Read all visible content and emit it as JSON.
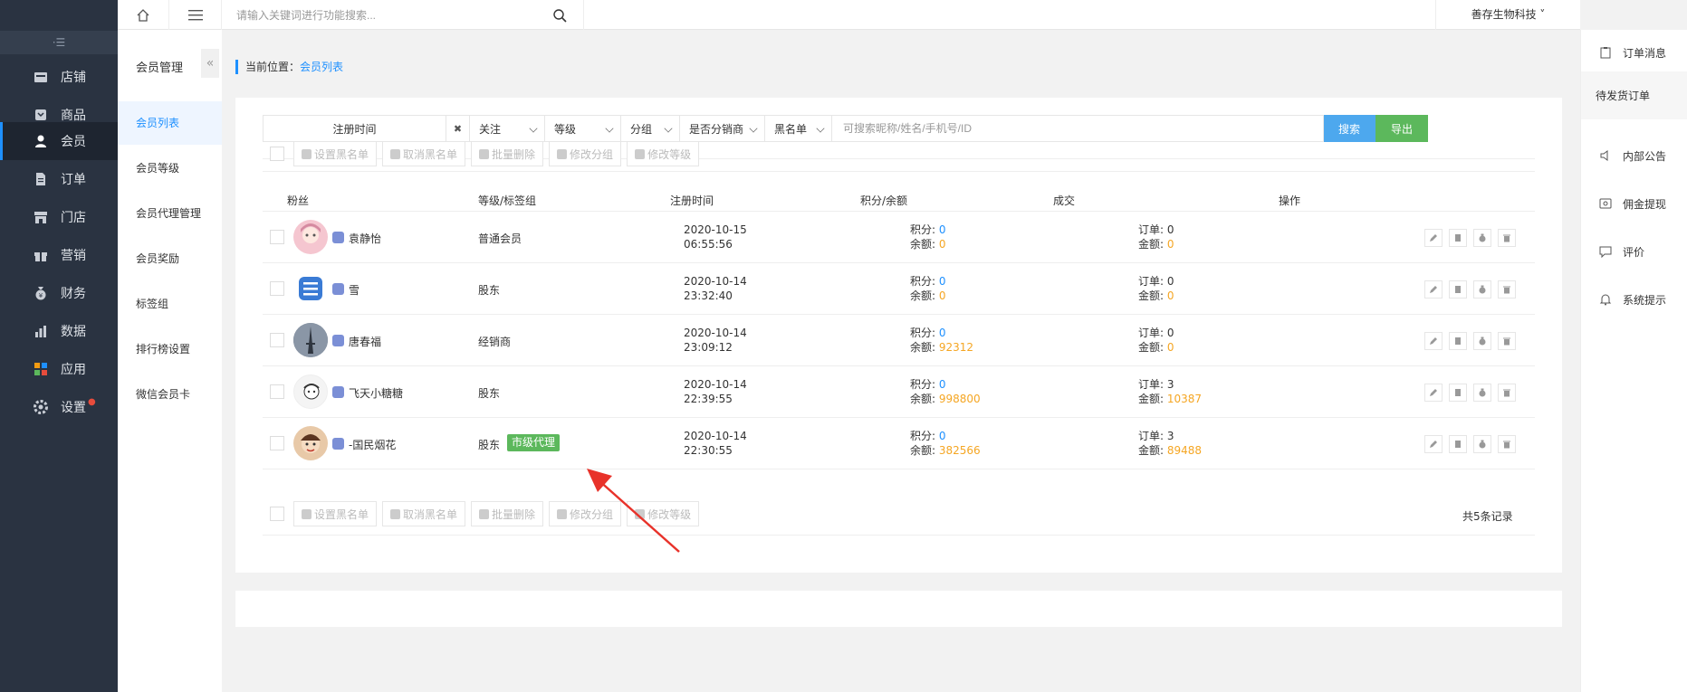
{
  "sidebar": {
    "collapse_label": "·☰",
    "items": [
      {
        "label": "店铺",
        "icon": "store-icon"
      },
      {
        "label": "商品",
        "icon": "goods-icon"
      },
      {
        "label": "会员",
        "icon": "user-icon",
        "active": true
      },
      {
        "label": "订单",
        "icon": "order-icon"
      },
      {
        "label": "门店",
        "icon": "shop-icon"
      },
      {
        "label": "营销",
        "icon": "gift-icon"
      },
      {
        "label": "财务",
        "icon": "money-bag-icon"
      },
      {
        "label": "数据",
        "icon": "chart-icon"
      },
      {
        "label": "应用",
        "icon": "apps-icon"
      },
      {
        "label": "设置",
        "icon": "gear-icon",
        "dot": "●"
      }
    ]
  },
  "subnav": {
    "title": "会员管理",
    "fold": "«",
    "items": [
      "会员列表",
      "会员等级",
      "会员代理管理",
      "会员奖励",
      "标签组",
      "排行榜设置",
      "微信会员卡"
    ]
  },
  "topbar": {
    "search_placeholder": "请输入关键词进行功能搜索...",
    "company": "善存生物科技 ˅"
  },
  "right_panel": {
    "items": [
      "订单消息",
      "待发货订单",
      "内部公告",
      "佣金提现",
      "评价",
      "系统提示"
    ]
  },
  "breadcrumb": {
    "prefix": "当前位置：",
    "current": "会员列表"
  },
  "filters": {
    "date": "注册时间",
    "clear": "✖",
    "follow": "关注",
    "level": "等级",
    "group": "分组",
    "distributor": "是否分销商",
    "blacklist": "黑名单",
    "search_placeholder": "可搜索昵称/姓名/手机号/ID",
    "search_btn": "搜索",
    "export_btn": "导出"
  },
  "toolbar": [
    "设置黑名单",
    "取消黑名单",
    "批量删除",
    "修改分组",
    "修改等级"
  ],
  "table": {
    "headers": [
      "粉丝",
      "等级/标签组",
      "注册时间",
      "积分/余额",
      "成交",
      "操作"
    ],
    "rows": [
      {
        "name": "袁静怡",
        "level": "普通会员",
        "tag": "",
        "date": "2020-10-15",
        "time": "06:55:56",
        "points_label": "积分:",
        "points": "0",
        "balance_label": "余额:",
        "balance": "0",
        "orders_label": "订单:",
        "orders": "0",
        "amount_label": "金额:",
        "amount": "0",
        "avatar_color": "#f5c6d0"
      },
      {
        "name": "雪",
        "level": "股东",
        "tag": "",
        "date": "2020-10-14",
        "time": "23:32:40",
        "points_label": "积分:",
        "points": "0",
        "balance_label": "余额:",
        "balance": "0",
        "orders_label": "订单:",
        "orders": "0",
        "amount_label": "金额:",
        "amount": "0",
        "avatar_color": "#3a7bd5"
      },
      {
        "name": "唐春福",
        "level": "经销商",
        "tag": "",
        "date": "2020-10-14",
        "time": "23:09:12",
        "points_label": "积分:",
        "points": "0",
        "balance_label": "余额:",
        "balance": "92312",
        "orders_label": "订单:",
        "orders": "0",
        "amount_label": "金额:",
        "amount": "0",
        "avatar_color": "#556070"
      },
      {
        "name": "飞天小糖糖",
        "level": "股东",
        "tag": "",
        "date": "2020-10-14",
        "time": "22:39:55",
        "points_label": "积分:",
        "points": "0",
        "balance_label": "余额:",
        "balance": "998800",
        "orders_label": "订单:",
        "orders": "3",
        "amount_label": "金额:",
        "amount": "10387",
        "avatar_color": "#f4f4f4"
      },
      {
        "name": "-国民烟花",
        "level": "股东",
        "tag": "市级代理",
        "date": "2020-10-14",
        "time": "22:30:55",
        "points_label": "积分:",
        "points": "0",
        "balance_label": "余额:",
        "balance": "382566",
        "orders_label": "订单:",
        "orders": "3",
        "amount_label": "金额:",
        "amount": "89488",
        "avatar_color": "#e8c9a8"
      }
    ]
  },
  "total": "共5条记录",
  "colors": {
    "accent": "#1e90ff",
    "sidebar": "#2a3341",
    "success": "#5cb85c",
    "warning": "#f5a623",
    "arrow": "#e8322a"
  }
}
